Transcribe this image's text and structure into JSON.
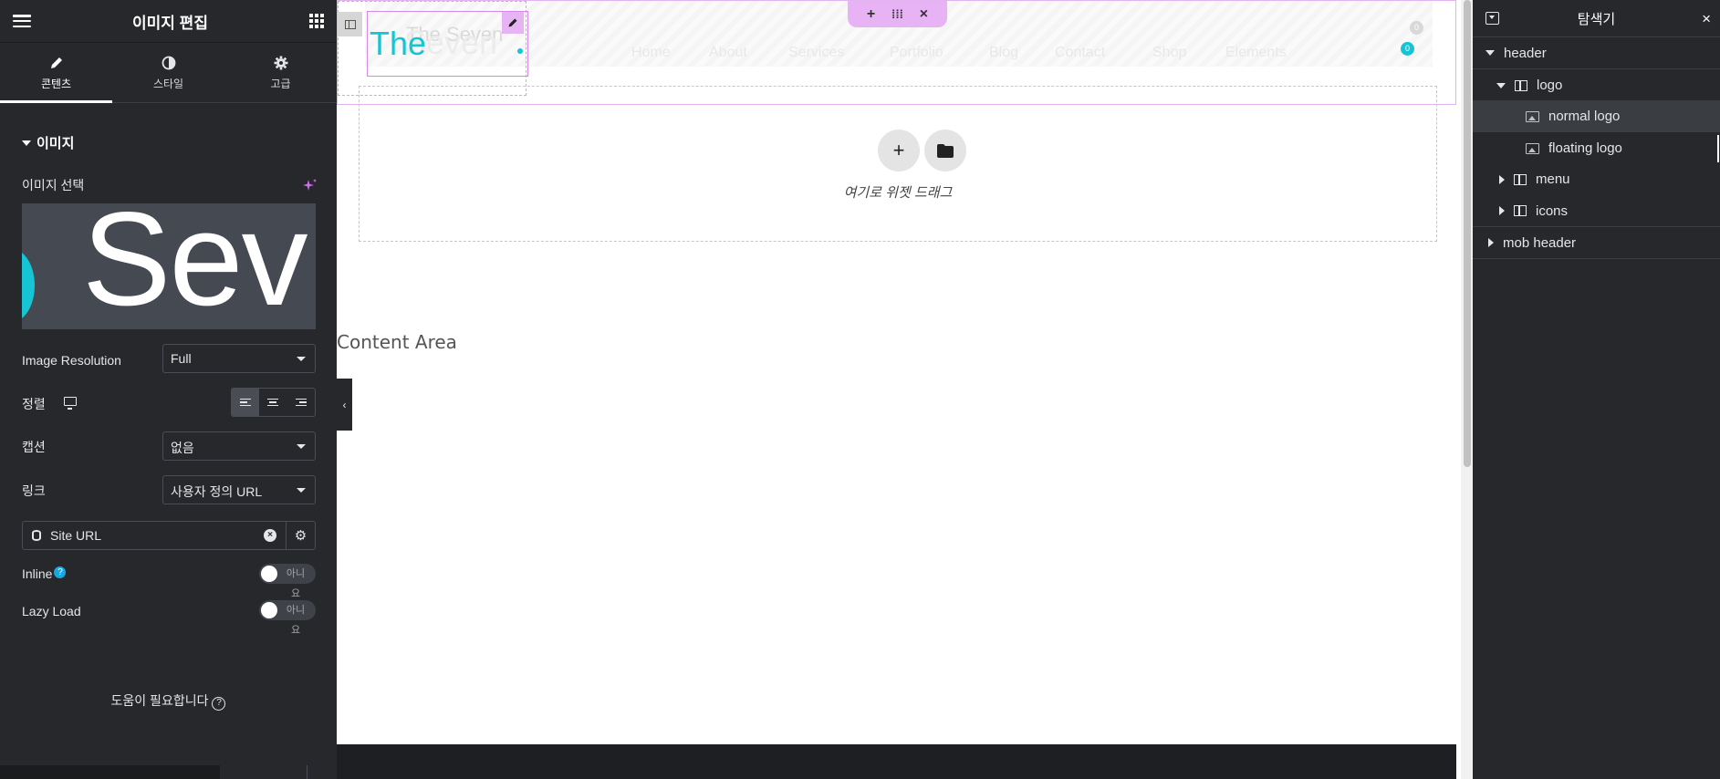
{
  "editor": {
    "title": "이미지 편집",
    "tabs": [
      {
        "label": "콘텐츠",
        "icon": "pencil-icon"
      },
      {
        "label": "스타일",
        "icon": "contrast-icon"
      },
      {
        "label": "고급",
        "icon": "gear-icon"
      }
    ],
    "section_title": "이미지",
    "image_select_label": "이미지 선택",
    "image_preview_text": "Sev",
    "resolution": {
      "label": "Image Resolution",
      "value": "Full"
    },
    "alignment": {
      "label": "정렬",
      "selected": "left"
    },
    "caption": {
      "label": "캡션",
      "value": "없음"
    },
    "link": {
      "label": "링크",
      "value": "사용자 정의 URL"
    },
    "url_field": {
      "value": "Site URL"
    },
    "inline": {
      "label": "Inline",
      "help": "?",
      "toggle_text": "아니요",
      "state": "off"
    },
    "lazy_load": {
      "label": "Lazy Load",
      "toggle_text": "아니요",
      "state": "off"
    },
    "help_text": "도움이 필요합니다",
    "help_icon": "?"
  },
  "canvas": {
    "logo_text": "The",
    "logo_ghost": "Seven",
    "logo_ghost_small": "The Seven",
    "nav_items": [
      "Home",
      "About",
      "Services",
      "Portfolio",
      "Blog",
      "Contact",
      "Shop",
      "Elements"
    ],
    "cart_badge": "0",
    "wishlist_badge": "0",
    "section_toolbar": {
      "add": "+",
      "drag": "⁞⁞⁞",
      "close": "×"
    },
    "drop_zone_text": "여기로 위젯 드래그",
    "drop_zone_add": "+",
    "content_area": "Content Area"
  },
  "navigator": {
    "title": "탐색기",
    "items": [
      {
        "label": "header",
        "expanded": true
      },
      {
        "label": "logo",
        "expanded": true
      },
      {
        "label": "normal logo",
        "selected": true
      },
      {
        "label": "floating logo"
      },
      {
        "label": "menu",
        "expanded": false
      },
      {
        "label": "icons",
        "expanded": false
      },
      {
        "label": "mob header",
        "expanded": false
      }
    ]
  },
  "colors": {
    "panel_bg": "#26282b",
    "accent_cyan": "#17c4d3",
    "edit_pink": "#e8b3f5",
    "help_blue": "#17a8e0"
  }
}
